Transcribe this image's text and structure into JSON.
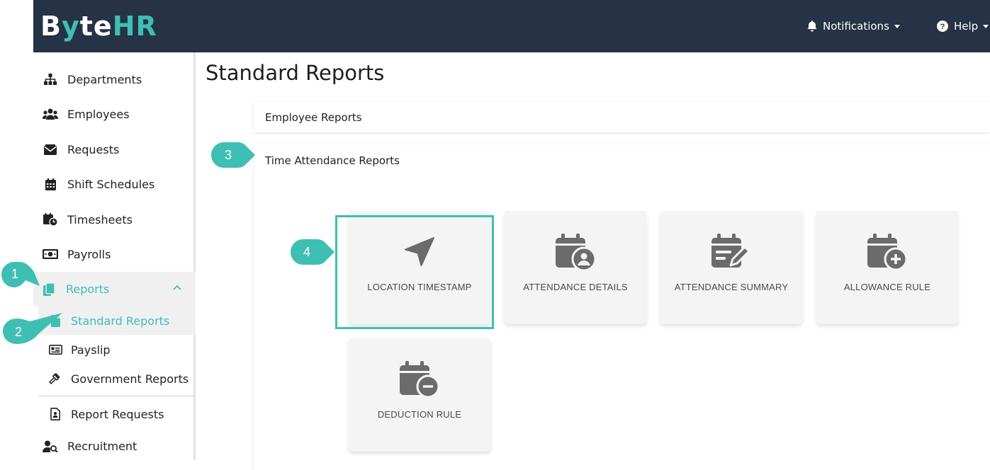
{
  "app": {
    "logo_white": "B",
    "logo_mid": "y",
    "logo_rest": "te",
    "logo_hr": "HR"
  },
  "nav": {
    "notifications": "Notifications",
    "help": "Help"
  },
  "sidebar": {
    "items": [
      {
        "label": "Departments",
        "icon": "sitemap-icon"
      },
      {
        "label": "Employees",
        "icon": "users-icon"
      },
      {
        "label": "Requests",
        "icon": "envelope-icon"
      },
      {
        "label": "Shift Schedules",
        "icon": "calendar-icon"
      },
      {
        "label": "Timesheets",
        "icon": "calendar-clock-icon"
      },
      {
        "label": "Payrolls",
        "icon": "money-icon"
      },
      {
        "label": "Reports",
        "icon": "copy-icon"
      }
    ],
    "sub_items": [
      {
        "label": "Standard Reports",
        "icon": "file-icon"
      },
      {
        "label": "Payslip",
        "icon": "id-card-icon"
      },
      {
        "label": "Government Reports",
        "icon": "gavel-icon"
      },
      {
        "label": "Report Requests",
        "icon": "file-person-icon"
      }
    ],
    "recruitment": {
      "label": "Recruitment",
      "icon": "user-search-icon"
    }
  },
  "main": {
    "title": "Standard Reports",
    "sections": [
      {
        "label": "Employee Reports"
      },
      {
        "label": "Time Attendance Reports"
      }
    ],
    "cards": [
      {
        "label": "LOCATION TIMESTAMP",
        "icon": "location-arrow-icon"
      },
      {
        "label": "ATTENDANCE DETAILS",
        "icon": "calendar-user-icon"
      },
      {
        "label": "ATTENDANCE SUMMARY",
        "icon": "calendar-edit-icon"
      },
      {
        "label": "ALLOWANCE RULE",
        "icon": "calendar-plus-icon"
      },
      {
        "label": "DEDUCTION RULE",
        "icon": "calendar-minus-icon"
      }
    ]
  },
  "callouts": [
    "1",
    "2",
    "3",
    "4"
  ],
  "colors": {
    "accent": "#3fbfb4",
    "topbar": "#263245",
    "card_bg": "#f4f4f4",
    "icon": "#6b6b6b"
  }
}
